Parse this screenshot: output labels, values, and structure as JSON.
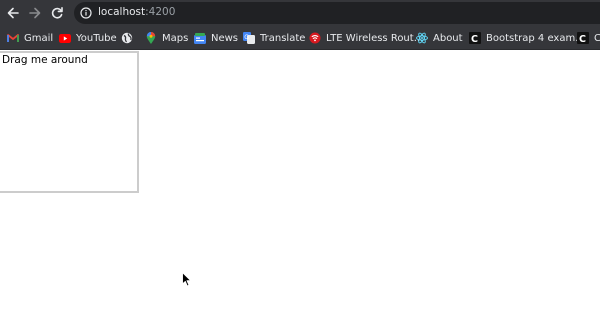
{
  "browser": {
    "url_host": "localhost",
    "url_port": ":4200",
    "icons": {
      "back": "arrow-left-icon",
      "forward": "arrow-right-icon",
      "reload": "reload-icon",
      "site_info": "info-icon"
    },
    "colors": {
      "toolbar_bg": "#35363a",
      "omnibox_bg": "#202124",
      "text": "#e8eaed"
    }
  },
  "bookmarks": [
    {
      "label": "Gmail",
      "icon": "gmail-icon"
    },
    {
      "label": "YouTube",
      "icon": "youtube-icon"
    },
    {
      "label": "",
      "icon": "globe-icon"
    },
    {
      "label": "Maps",
      "icon": "maps-icon"
    },
    {
      "label": "News",
      "icon": "news-icon"
    },
    {
      "label": "Translate",
      "icon": "translate-icon"
    },
    {
      "label": "LTE Wireless Rout...",
      "icon": "router-icon"
    },
    {
      "label": "About",
      "icon": "react-icon"
    },
    {
      "label": "Bootstrap 4 exam...",
      "icon": "codeply-icon"
    },
    {
      "label": "Co",
      "icon": "codeply-icon"
    }
  ],
  "page": {
    "drag_box_text": "Drag me around",
    "drag_box_border_color": "#cccccc"
  }
}
